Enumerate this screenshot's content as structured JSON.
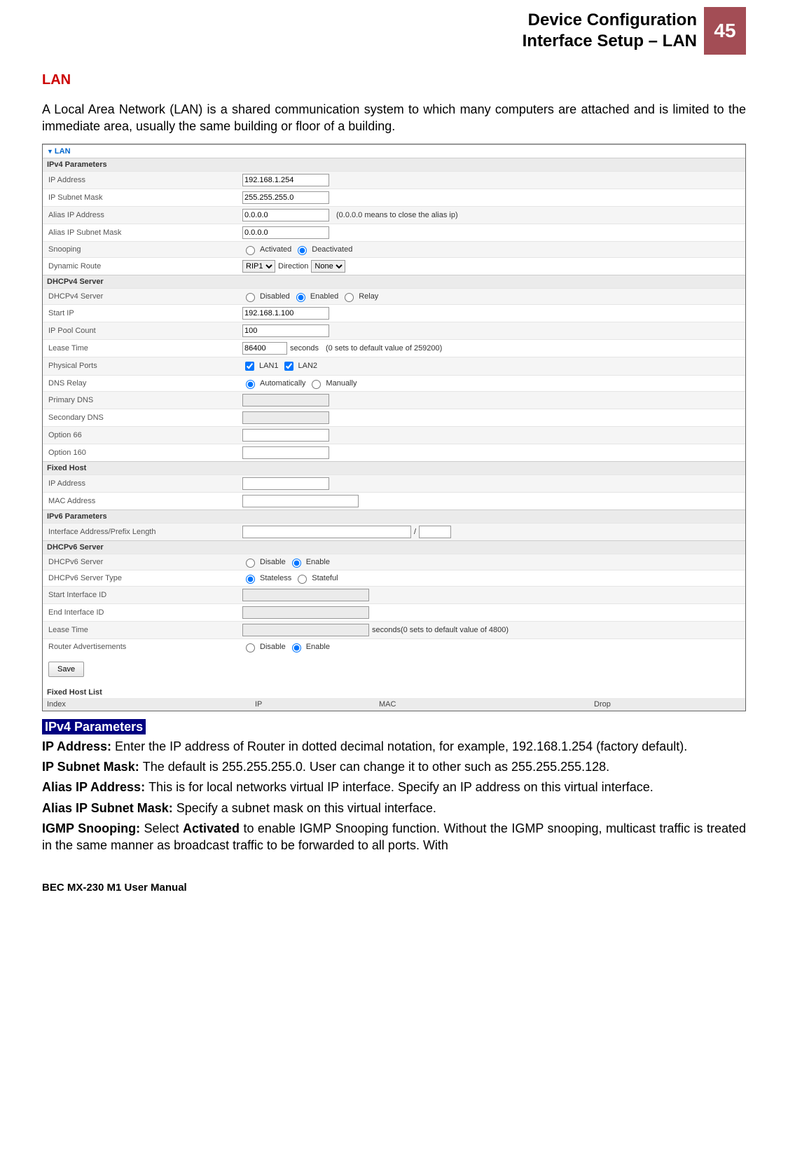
{
  "header": {
    "line1": "Device Configuration",
    "line2": "Interface Setup – LAN",
    "page": "45"
  },
  "lan_heading": "LAN",
  "intro": "A Local Area Network (LAN) is a shared communication system to which many computers are attached and is limited to the immediate area, usually the same building or floor of a building.",
  "ss": {
    "panel": "LAN",
    "ipv4": {
      "hdr": "IPv4 Parameters",
      "ip_lbl": "IP Address",
      "ip": "192.168.1.254",
      "mask_lbl": "IP Subnet Mask",
      "mask": "255.255.255.0",
      "aip_lbl": "Alias IP Address",
      "aip": "0.0.0.0",
      "aip_note": "(0.0.0.0 means to close the alias ip)",
      "amask_lbl": "Alias IP Subnet Mask",
      "amask": "0.0.0.0",
      "snoop_lbl": "Snooping",
      "snoop_a": "Activated",
      "snoop_d": "Deactivated",
      "dyn_lbl": "Dynamic Route",
      "dyn_v": "RIP1",
      "dir_lbl": "Direction",
      "dir_v": "None"
    },
    "dhcp4": {
      "hdr": "DHCPv4 Server",
      "srv_lbl": "DHCPv4 Server",
      "dis": "Disabled",
      "en": "Enabled",
      "rel": "Relay",
      "sip_lbl": "Start IP",
      "sip": "192.168.1.100",
      "pool_lbl": "IP Pool Count",
      "pool": "100",
      "lt_lbl": "Lease Time",
      "lt": "86400",
      "lt_unit": "seconds",
      "lt_note": "(0 sets to default value of 259200)",
      "pp_lbl": "Physical Ports",
      "pp1": "LAN1",
      "pp2": "LAN2",
      "dns_lbl": "DNS Relay",
      "dns_a": "Automatically",
      "dns_m": "Manually",
      "pdns_lbl": "Primary DNS",
      "sdns_lbl": "Secondary DNS",
      "o66": "Option 66",
      "o160": "Option 160"
    },
    "fh": {
      "hdr": "Fixed Host",
      "ip_lbl": "IP Address",
      "mac_lbl": "MAC Address"
    },
    "ipv6": {
      "hdr": "IPv6 Parameters",
      "ifa_lbl": "Interface Address/Prefix Length",
      "sep": "/"
    },
    "dhcp6": {
      "hdr": "DHCPv6 Server",
      "srv_lbl": "DHCPv6 Server",
      "dis": "Disable",
      "en": "Enable",
      "type_lbl": "DHCPv6 Server Type",
      "sl": "Stateless",
      "sf": "Stateful",
      "sid_lbl": "Start Interface ID",
      "eid_lbl": "End Interface ID",
      "lt_lbl": "Lease Time",
      "lt_note": "seconds(0 sets to default value of 4800)",
      "ra_lbl": "Router Advertisements"
    },
    "save": "Save",
    "fhl": {
      "title": "Fixed Host List",
      "idx": "Index",
      "ip": "IP",
      "mac": "MAC",
      "drop": "Drop"
    }
  },
  "sec_badge": "IPv4 Parameters",
  "p1_b": "IP Address: ",
  "p1": "Enter the IP address of Router in dotted decimal notation, for example, 192.168.1.254 (factory default).",
  "p2_b": "IP Subnet Mask: ",
  "p2": "The default is 255.255.255.0. User can change it to other such as 255.255.255.128.",
  "p3_b": "Alias IP Address: ",
  "p3": "This is for local networks virtual IP interface. Specify an IP address on this virtual interface.",
  "p4_b": "Alias IP Subnet Mask: ",
  "p4": "Specify a subnet mask on this virtual interface.",
  "p5_b": "IGMP Snooping: ",
  "p5a": "Select ",
  "p5_b2": "Activated",
  "p5b": " to enable IGMP Snooping function. Without the IGMP snooping, multicast traffic is treated in the same manner as broadcast traffic to be forwarded to all ports. With",
  "footer": "BEC MX-230 M1 User Manual"
}
